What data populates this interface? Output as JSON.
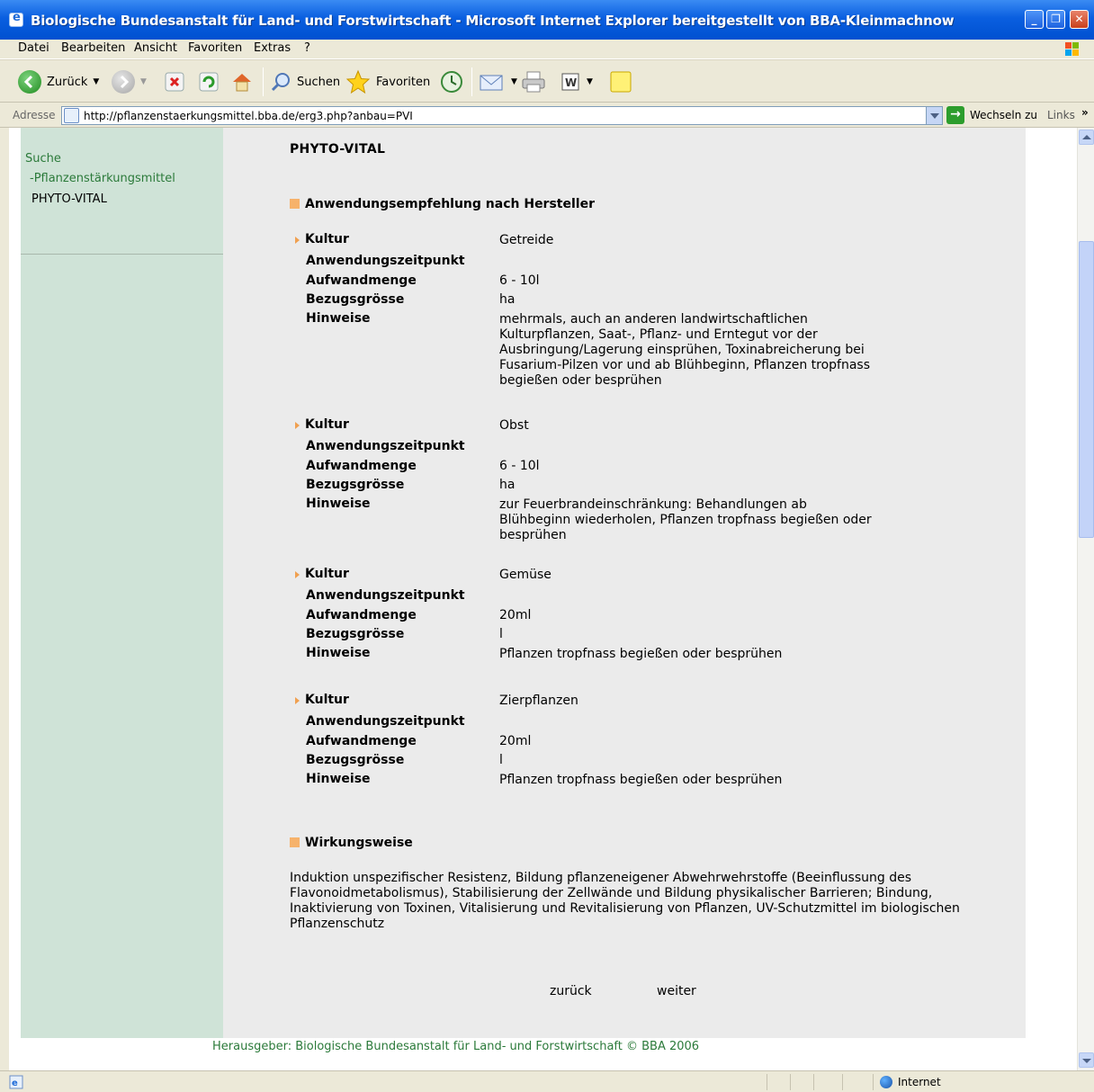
{
  "window": {
    "title": "Biologische Bundesanstalt für Land- und Forstwirtschaft - Microsoft Internet Explorer bereitgestellt von BBA-Kleinmachnow"
  },
  "menu": [
    "Datei",
    "Bearbeiten",
    "Ansicht",
    "Favoriten",
    "Extras",
    "?"
  ],
  "toolbar": {
    "back_label": "Zurück",
    "search_label": "Suchen",
    "favorites_label": "Favoriten"
  },
  "address": {
    "label": "Adresse",
    "url": "http://pflanzenstaerkungsmittel.bba.de/erg3.php?anbau=PVI",
    "go_label": "Wechseln zu",
    "links_label": "Links"
  },
  "sidebar": {
    "item1": "Suche",
    "item2": "-Pflanzenstärkungsmittel",
    "item3": "PHYTO-VITAL"
  },
  "page": {
    "title": "PHYTO-VITAL",
    "section1": "Anwendungsempfehlung nach Hersteller",
    "labels": {
      "kultur": "Kultur",
      "zeitpunkt": "Anwendungszeitpunkt",
      "menge": "Aufwandmenge",
      "bezug": "Bezugsgrösse",
      "hinweise": "Hinweise"
    },
    "entries": [
      {
        "kultur": "Getreide",
        "zeitpunkt": "",
        "menge": "6 - 10l",
        "bezug": "ha",
        "hinweise": "mehrmals, auch an anderen landwirtschaftlichen Kulturpflanzen, Saat-, Pflanz- und Erntegut vor der Ausbringung/Lagerung einsprühen, Toxinabreicherung bei Fusarium-Pilzen vor und ab Blühbeginn, Pflanzen tropfnass begießen oder besprühen"
      },
      {
        "kultur": "Obst",
        "zeitpunkt": "",
        "menge": "6 - 10l",
        "bezug": "ha",
        "hinweise": "zur Feuerbrandeinschränkung: Behandlungen ab Blühbeginn wiederholen, Pflanzen tropfnass begießen oder besprühen"
      },
      {
        "kultur": "Gemüse",
        "zeitpunkt": "",
        "menge": "20ml",
        "bezug": "l",
        "hinweise": "Pflanzen tropfnass begießen oder besprühen"
      },
      {
        "kultur": "Zierpflanzen",
        "zeitpunkt": "",
        "menge": "20ml",
        "bezug": "l",
        "hinweise": "Pflanzen tropfnass begießen oder besprühen"
      }
    ],
    "section2": "Wirkungsweise",
    "wirkung": "Induktion unspezifischer Resistenz, Bildung pflanzeneigener Abwehrwehrstoffe (Beeinflussung des Flavonoidmetabolismus), Stabilisierung der Zellwände und Bildung physikalischer Barrieren; Bindung, Inaktivierung von Toxinen, Vitalisierung und Revitalisierung von Pflanzen, UV-Schutzmittel im biologischen Pflanzenschutz",
    "nav_back": "zurück",
    "nav_next": "weiter",
    "footer": "Herausgeber: Biologische Bundesanstalt für Land- und Forstwirtschaft © BBA 2006"
  },
  "status": {
    "zone": "Internet"
  }
}
